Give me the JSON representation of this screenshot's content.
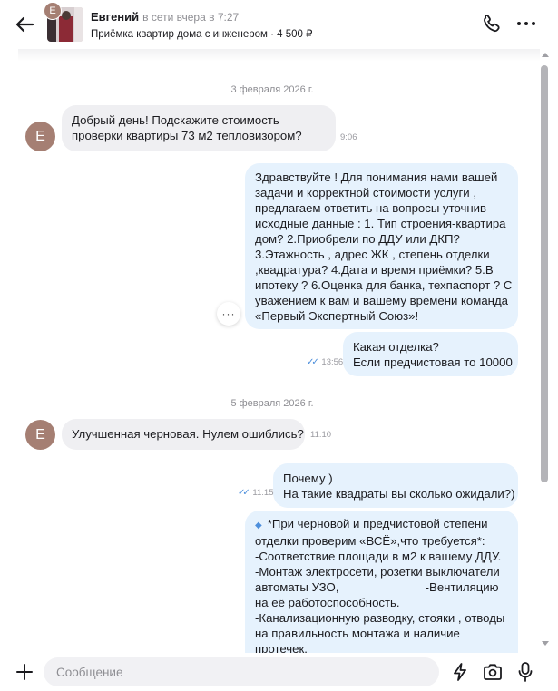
{
  "header": {
    "contact_name": "Евгений",
    "contact_status": "в сети вчера в 7:27",
    "ad_title": "Приёмка квартир дома с инженером · 4 500 ₽",
    "avatar_initial": "Е"
  },
  "chat": {
    "date_1": "3 февраля 2026 г.",
    "date_2": "5 февраля 2026 г.",
    "messages": [
      {
        "direction": "incoming",
        "avatar_initial": "Е",
        "lines": [
          "Добрый день! Подскажите стоимость",
          "проверки квартиры 73 м2  тепловизором?"
        ],
        "time": "9:06"
      },
      {
        "direction": "outgoing",
        "lines": [
          "Здравствуйте ! Для понимания нами вашей",
          "задачи и корректной стоимости услуги ,",
          "предлагаем ответить на вопросы уточнив",
          "исходные данные : 1. Тип строения-квартира",
          "дом? 2.Приобрели по ДДУ или ДКП?",
          "3.Этажность , адрес ЖК , степень отделки",
          ",квадратура? 4.Дата и время приёмки? 5.В",
          "ипотеку ? 6.Оценка для банка, техпаспорт ? С",
          "уважением к вам и вашему времени команда",
          "«Первый Экспертный Союз»!"
        ],
        "menu_label": "···"
      },
      {
        "direction": "outgoing",
        "lines": [
          "Какая отделка?",
          "Если предчистовая то 10000"
        ],
        "time": "13:56",
        "ticks": "✓✓"
      },
      {
        "direction": "incoming",
        "avatar_initial": "Е",
        "lines": [
          "Улучшенная черновая. Нулем ошиблись?"
        ],
        "time": "11:10"
      },
      {
        "direction": "outgoing",
        "lines": [
          "Почему )",
          "На такие квадраты вы сколько ожидали?)"
        ],
        "time": "11:15",
        "ticks": "✓✓"
      },
      {
        "direction": "outgoing",
        "marker": "◆",
        "lines": [
          "*При черновой и предчистовой степени",
          "отделки проверим  «ВСЁ»,что требуется*:",
          "-Соответствие площади в м2 к вашему ДДУ.",
          "-Монтаж электросети, розетки выключатели",
          "автоматы УЗО,                          -Вентиляцию",
          "на её работоспособность.",
          "-Канализационную разводку, стояки , отводы",
          "на правильность монтажа и наличие",
          "протечек."
        ]
      }
    ]
  },
  "input": {
    "placeholder": "Сообщение",
    "value": ""
  },
  "icons": {
    "back": "arrow-left-icon",
    "phone": "phone-icon",
    "more": "more-dots-icon",
    "attach": "plus-icon",
    "quick_reply": "lightning-icon",
    "camera": "camera-icon",
    "mic": "microphone-icon"
  },
  "colors": {
    "incoming_bubble": "#efeff2",
    "outgoing_bubble": "#e6f2fd",
    "avatar": "#a57f73",
    "read_ticks": "#4d8fdc"
  }
}
